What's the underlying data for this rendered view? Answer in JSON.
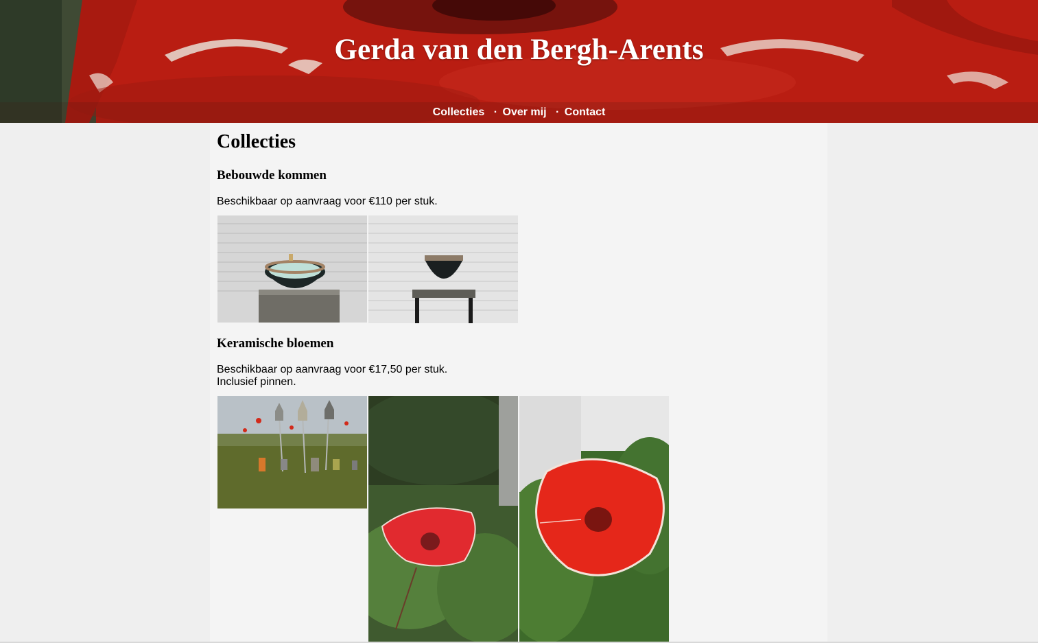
{
  "site": {
    "title": "Gerda van den Bergh-Arents"
  },
  "nav": {
    "items": [
      {
        "label": "Collecties"
      },
      {
        "label": "Over mij"
      },
      {
        "label": "Contact"
      }
    ],
    "separator": "·"
  },
  "page": {
    "title": "Collecties"
  },
  "sections": [
    {
      "title": "Bebouwde kommen",
      "text_lines": [
        "Beschikbaar op aanvraag voor €110 per stuk."
      ],
      "photos": [
        "bowl-on-pedestal-photo",
        "bowl-side-view-photo"
      ]
    },
    {
      "title": "Keramische bloemen",
      "text_lines": [
        "Beschikbaar op aanvraag voor €17,50 per stuk.",
        "Inclusief pinnen."
      ],
      "photos": [
        "field-installation-photo",
        "poppy-in-garden-photo",
        "poppy-closeup-photo"
      ]
    }
  ],
  "colors": {
    "banner_red": "#c0261a",
    "content_bg": "#f4f4f4",
    "page_bg": "#efefef"
  }
}
